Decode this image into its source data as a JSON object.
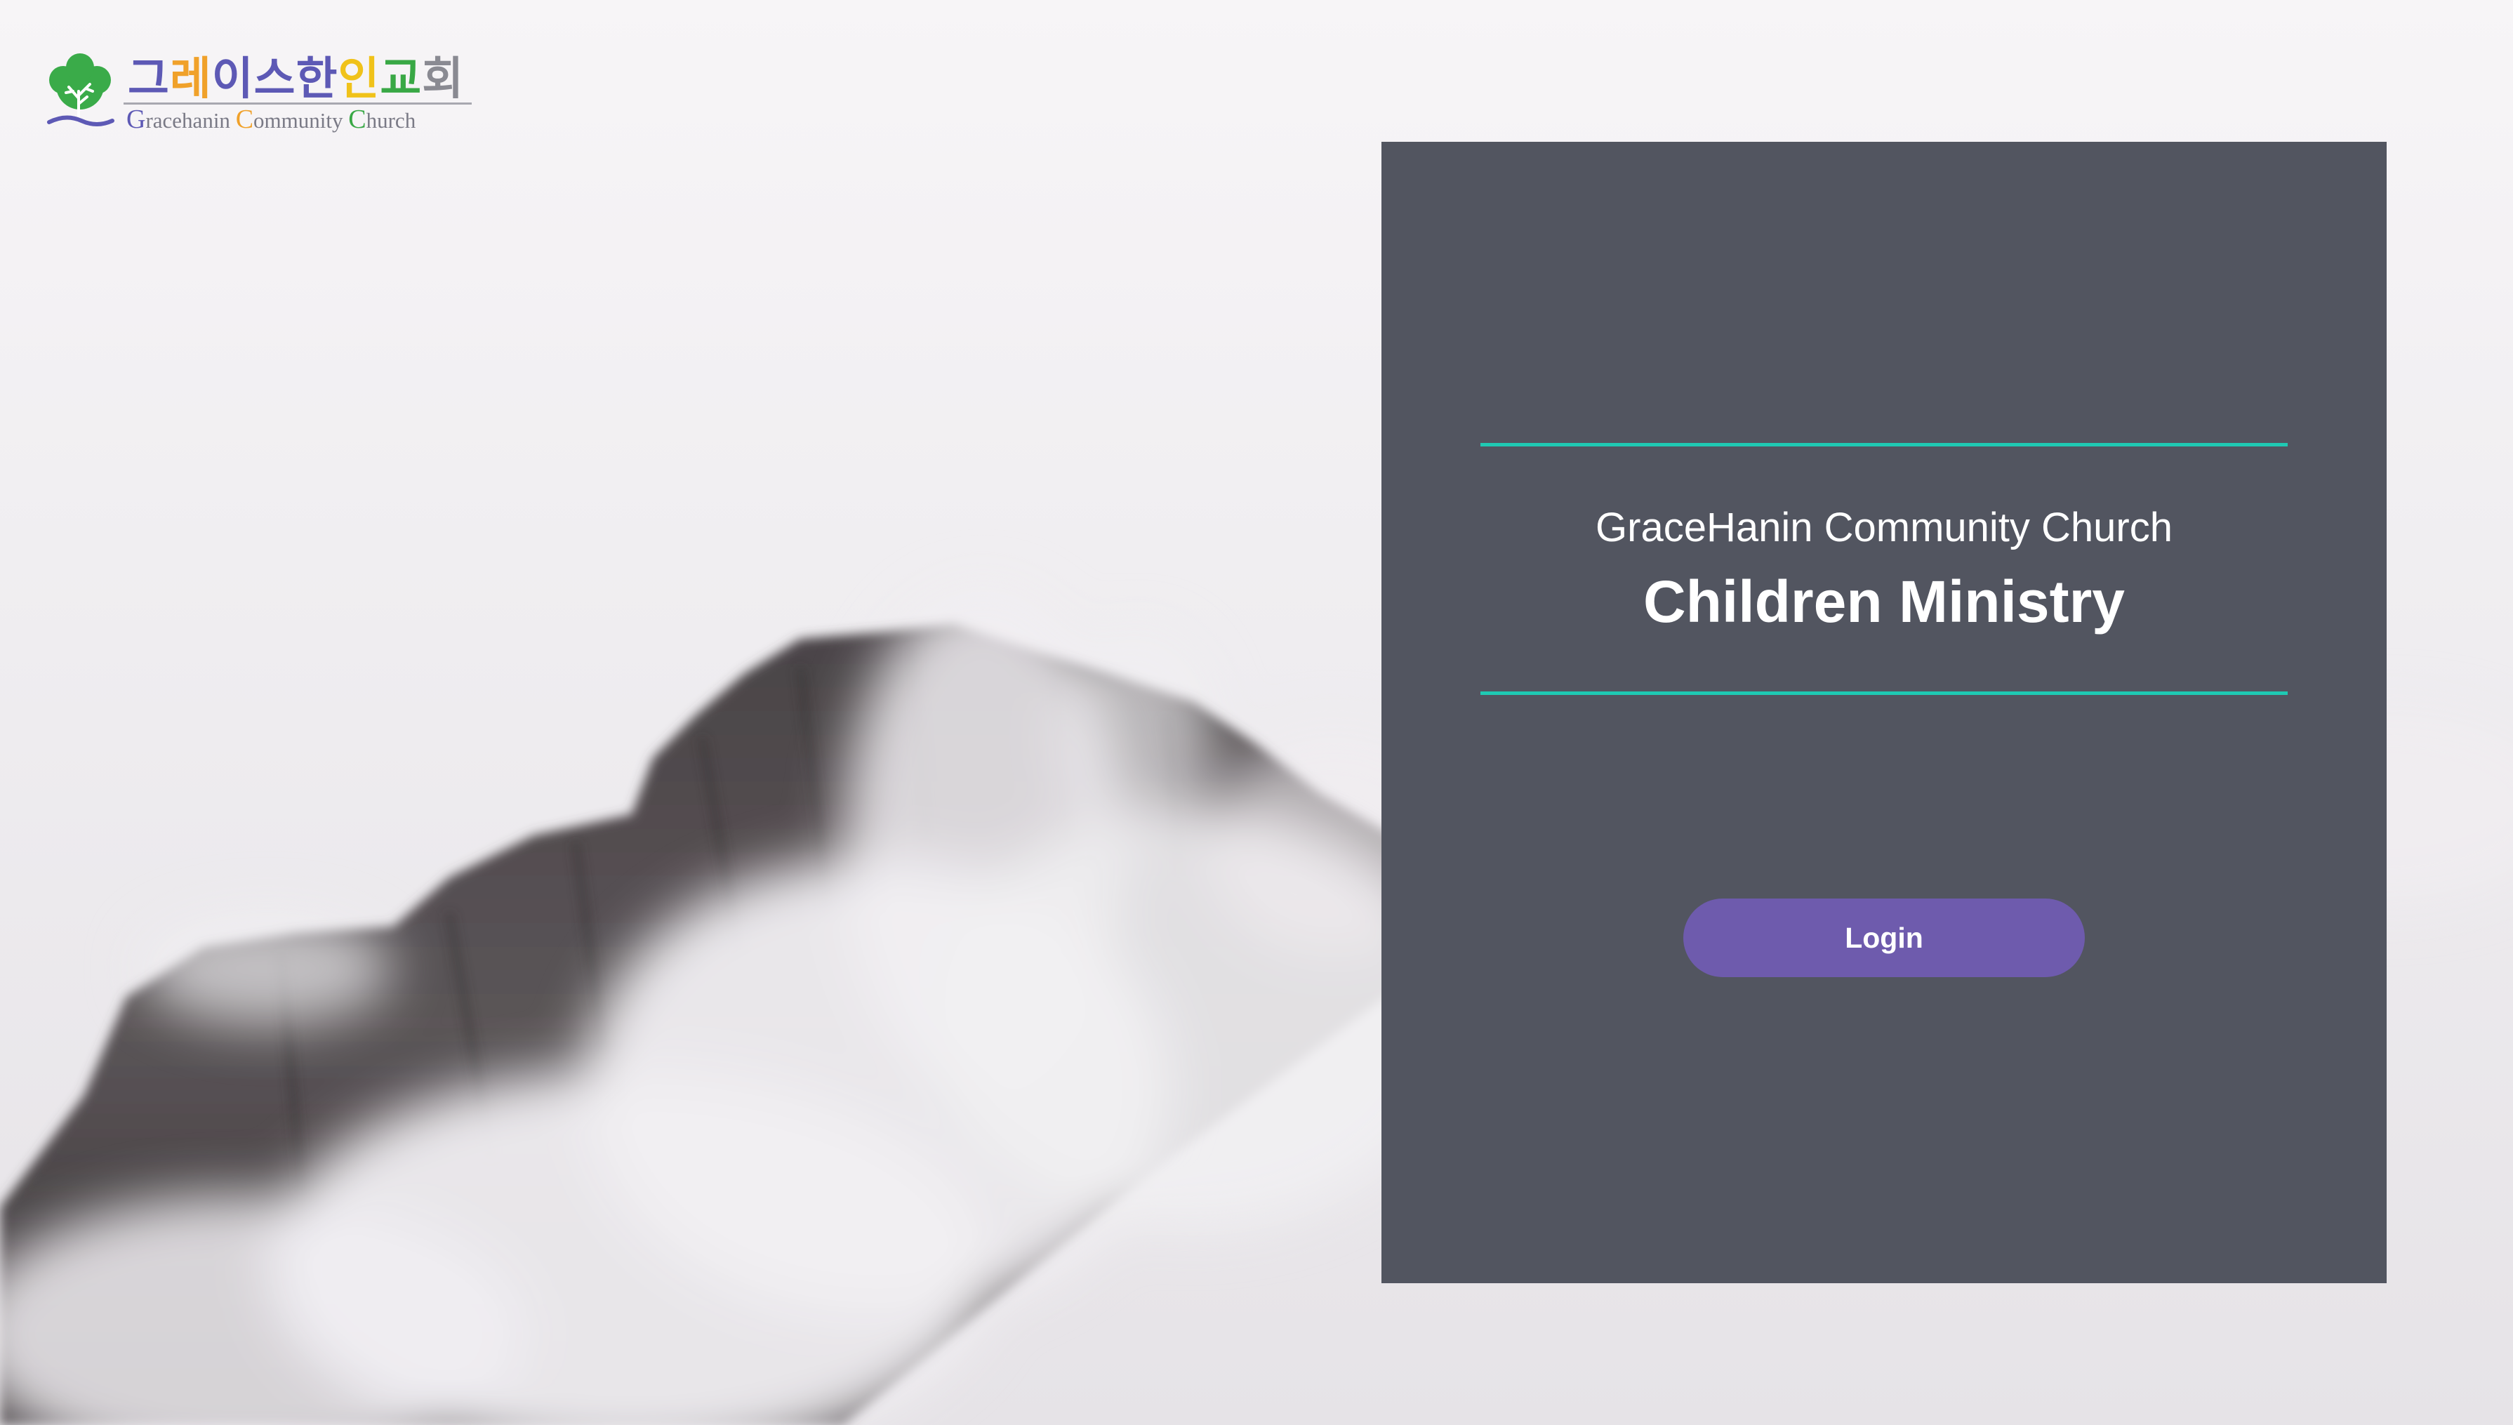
{
  "logo": {
    "korean_chars": [
      {
        "text": "그",
        "color": "#5d59b5"
      },
      {
        "text": "레",
        "color": "#f0a12a"
      },
      {
        "text": "이",
        "color": "#5d59b5"
      },
      {
        "text": "스",
        "color": "#5d59b5"
      },
      {
        "text": "한",
        "color": "#5d59b5"
      },
      {
        "text": "인",
        "color": "#f0c21a"
      },
      {
        "text": "교",
        "color": "#39a845"
      },
      {
        "text": "회",
        "color": "#8a8a92"
      }
    ],
    "english_parts": [
      {
        "text": "G",
        "color": "#5d59b5",
        "big": true
      },
      {
        "text": "racehanin ",
        "color": "#7a7a86",
        "big": false
      },
      {
        "text": "C",
        "color": "#f0a12a",
        "big": true
      },
      {
        "text": "ommunity ",
        "color": "#7a7a86",
        "big": false
      },
      {
        "text": "C",
        "color": "#39a845",
        "big": true
      },
      {
        "text": "hurch",
        "color": "#7a7a86",
        "big": false
      }
    ],
    "mark_color": "#3aab49",
    "icon": "tree-logo-icon"
  },
  "panel": {
    "church_name": "GraceHanin Community Church",
    "ministry_title": "Children Ministry",
    "login_label": "Login",
    "accent_color": "#1fc9b3",
    "button_color": "#6e5bad",
    "panel_color": "#525560"
  }
}
